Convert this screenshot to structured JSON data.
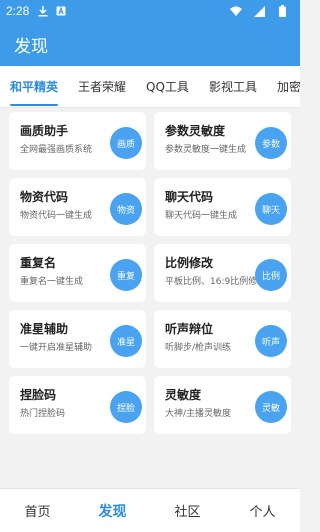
{
  "status_bar": {
    "time": "2:28",
    "icons": [
      "download-icon",
      "notification-a-icon",
      "wifi-icon",
      "signal-icon",
      "battery-icon"
    ]
  },
  "app_bar": {
    "title": "发现"
  },
  "tabs": [
    {
      "label": "和平精英",
      "active": true
    },
    {
      "label": "王者荣耀",
      "active": false
    },
    {
      "label": "QQ工具",
      "active": false
    },
    {
      "label": "影视工具",
      "active": false
    },
    {
      "label": "加密工",
      "active": false
    }
  ],
  "cards": [
    {
      "title": "画质助手",
      "desc": "全网最强画质系统",
      "badge": "画质"
    },
    {
      "title": "参数灵敏度",
      "desc": "参数灵敏度一键生成",
      "badge": "参数"
    },
    {
      "title": "物资代码",
      "desc": "物资代码一键生成",
      "badge": "物资"
    },
    {
      "title": "聊天代码",
      "desc": "聊天代码一键生成",
      "badge": "聊天"
    },
    {
      "title": "重复名",
      "desc": "重复名一键生成",
      "badge": "重复"
    },
    {
      "title": "比例修改",
      "desc": "平板比例、16:9比例修改",
      "badge": "比例"
    },
    {
      "title": "准星辅助",
      "desc": "一键开启准星辅助",
      "badge": "准星"
    },
    {
      "title": "听声辩位",
      "desc": "听脚步/枪声训练",
      "badge": "听声"
    },
    {
      "title": "捏脸码",
      "desc": "热门捏脸码",
      "badge": "捏脸"
    },
    {
      "title": "灵敏度",
      "desc": "大神/主播灵敏度",
      "badge": "灵敏"
    }
  ],
  "bottom_nav": [
    {
      "label": "首页",
      "active": false
    },
    {
      "label": "发现",
      "active": true
    },
    {
      "label": "社区",
      "active": false
    },
    {
      "label": "个人",
      "active": false
    }
  ],
  "colors": {
    "primary": "#3d9be9",
    "accent": "#2d8ce0",
    "badge": "#4aa3f0"
  }
}
